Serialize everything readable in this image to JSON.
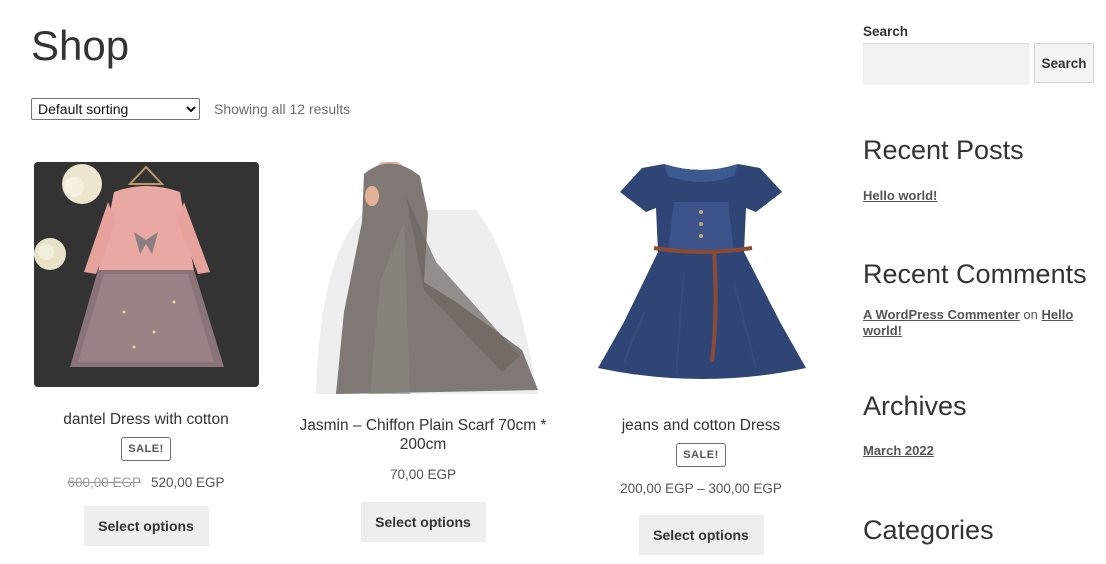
{
  "page": {
    "title": "Shop"
  },
  "toolbar": {
    "sort_options": [
      "Default sorting"
    ],
    "sort_selected": "Default sorting",
    "result_count": "Showing all 12 results"
  },
  "products": [
    {
      "title": "dantel Dress with cotton",
      "sale_badge": "SALE!",
      "old_price": "600,00 EGP",
      "price": "520,00 EGP",
      "button": "Select options",
      "image": "pink-tulle-dress-photo"
    },
    {
      "title": "Jasmin – Chiffon Plain Scarf 70cm * 200cm",
      "price": "70,00 EGP",
      "button": "Select options",
      "image": "grey-chiffon-scarf-photo"
    },
    {
      "title": "jeans and cotton Dress",
      "sale_badge": "SALE!",
      "price": "200,00 EGP – 300,00 EGP",
      "button": "Select options",
      "image": "denim-dress-photo"
    }
  ],
  "sidebar": {
    "search_label": "Search",
    "search_button": "Search",
    "recent_posts_title": "Recent Posts",
    "recent_posts": [
      "Hello world!"
    ],
    "recent_comments_title": "Recent Comments",
    "recent_comment": {
      "author": "A WordPress Commenter",
      "connector": "on",
      "post": "Hello world!"
    },
    "archives_title": "Archives",
    "archives": [
      "March 2022"
    ],
    "categories_title": "Categories"
  }
}
